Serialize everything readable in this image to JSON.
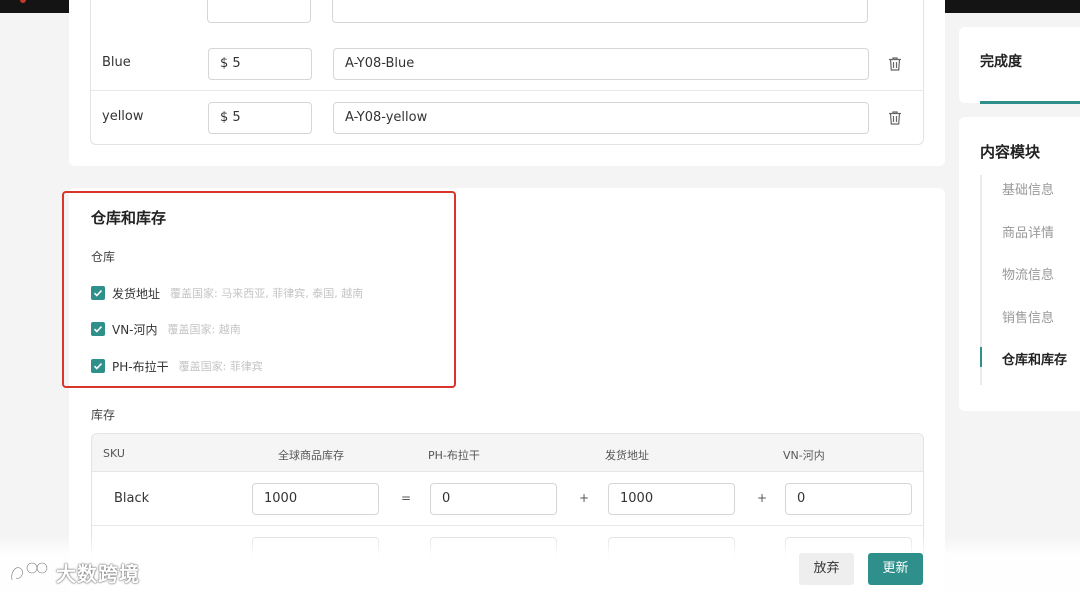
{
  "variants": [
    {
      "name": "Blue",
      "currency": "$",
      "price": "5",
      "sku": "A-Y08-Blue"
    },
    {
      "name": "yellow",
      "currency": "$",
      "price": "5",
      "sku": "A-Y08-yellow"
    }
  ],
  "warehouse_section": {
    "title": "仓库和库存",
    "warehouse_label": "仓库",
    "warehouses": [
      {
        "name": "发货地址",
        "coverage": "覆盖国家: 马来西亚, 菲律宾, 泰国, 越南",
        "checked": true
      },
      {
        "name": "VN-河内",
        "coverage": "覆盖国家: 越南",
        "checked": true
      },
      {
        "name": "PH-布拉干",
        "coverage": "覆盖国家: 菲律宾",
        "checked": true
      }
    ],
    "inventory_label": "库存",
    "inventory_headers": [
      "SKU",
      "全球商品库存",
      "PH-布拉干",
      "发货地址",
      "VN-河内"
    ],
    "inventory_rows": [
      {
        "sku": "Black",
        "global": "1000",
        "eq": "=",
        "ph": "0",
        "plus1": "+",
        "ship": "1000",
        "plus2": "+",
        "vn": "0"
      }
    ]
  },
  "progress": {
    "label": "完成度",
    "fraction": 1.0
  },
  "nav": {
    "title": "内容模块",
    "items": [
      "基础信息",
      "商品详情",
      "物流信息",
      "销售信息",
      "仓库和库存"
    ],
    "active_index": 4
  },
  "actions": {
    "discard": "放弃",
    "update": "更新"
  },
  "watermark": "大数跨境",
  "colors": {
    "accent": "#2f8f8a",
    "highlight": "#d9362b"
  }
}
